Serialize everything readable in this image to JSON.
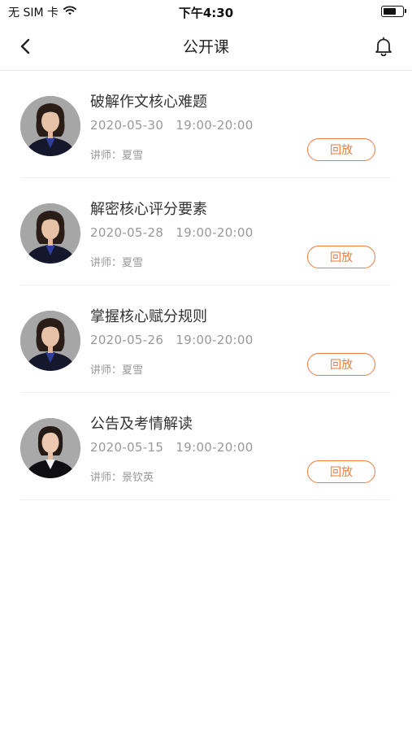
{
  "status_bar": {
    "carrier": "无 SIM 卡",
    "time": "下午4:30",
    "battery_level": 0.75
  },
  "nav": {
    "title": "公开课",
    "back_icon": "chevron-left-icon",
    "bell_icon": "bell-icon"
  },
  "courses": [
    {
      "title": "破解作文核心难题",
      "date": "2020-05-30",
      "time": "19:00-20:00",
      "lecturer": "讲师：夏雪",
      "button": "回放"
    },
    {
      "title": "解密核心评分要素",
      "date": "2020-05-28",
      "time": "19:00-20:00",
      "lecturer": "讲师：夏雪",
      "button": "回放"
    },
    {
      "title": "掌握核心赋分规则",
      "date": "2020-05-26",
      "time": "19:00-20:00",
      "lecturer": "讲师：夏雪",
      "button": "回放"
    },
    {
      "title": "公告及考情解读",
      "date": "2020-05-15",
      "time": "19:00-20:00",
      "lecturer": "讲师：景钦英",
      "button": "回放"
    }
  ],
  "colors": {
    "accent": "#f07a3c",
    "title_text": "#333333",
    "muted_text": "#999999"
  }
}
